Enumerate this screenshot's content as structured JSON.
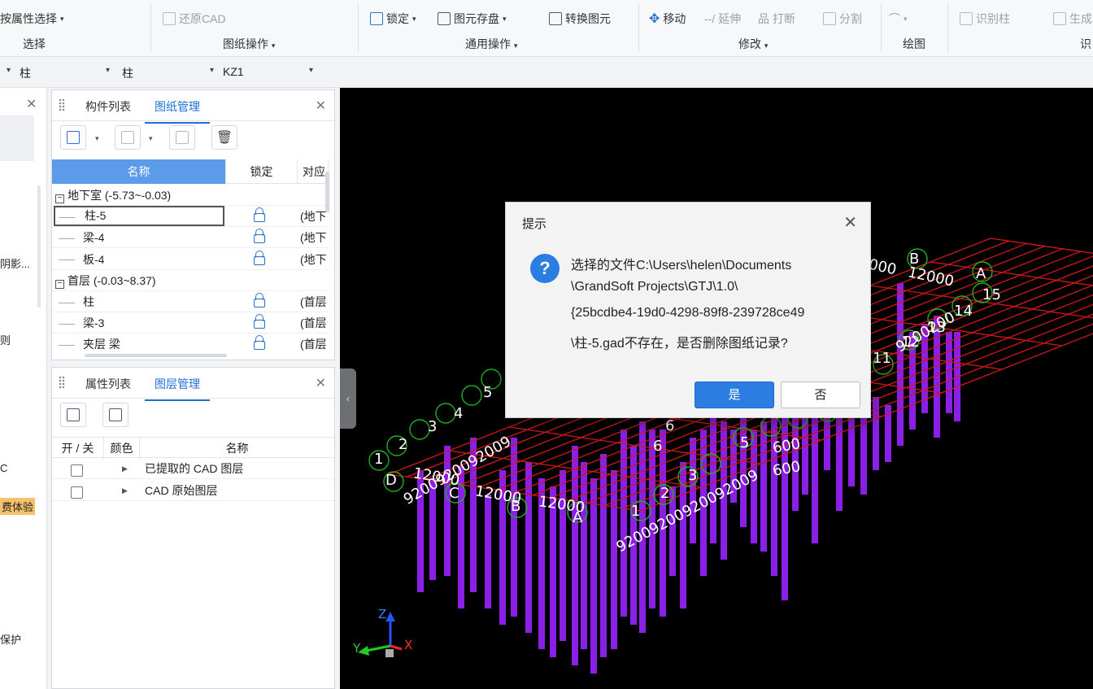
{
  "ribbon": {
    "row1": {
      "prop_select": "按属性选择",
      "restore_cad": "还原CAD",
      "lock": "锁定",
      "save_element": "图元存盘",
      "convert_element": "转换图元",
      "move": "移动",
      "extend": "延伸",
      "break": "打断",
      "split": "分割",
      "identify_column": "识别柱",
      "generate": "生成"
    },
    "groups": {
      "select": "选择",
      "drawing_ops": "图纸操作",
      "common_ops": "通用操作",
      "modify": "修改",
      "draw": "绘图",
      "identify": "识"
    }
  },
  "selector": {
    "floor_partial": "",
    "category": "柱",
    "subcategory": "柱",
    "element": "KZ1"
  },
  "left_strip": {
    "shadow_text": "阴影...",
    "char1": "则",
    "char2": "C",
    "trial_badge": "费体验",
    "protect": "保护"
  },
  "drawing_panel": {
    "tab_components": "构件列表",
    "tab_drawings": "图纸管理",
    "headers": {
      "name": "名称",
      "lock": "锁定",
      "corr": "对应"
    },
    "rows": [
      {
        "type": "group",
        "name": "地下室 (-5.73~-0.03)"
      },
      {
        "type": "item",
        "name": "柱-5",
        "corr": "(地下"
      },
      {
        "type": "item",
        "name": "梁-4",
        "corr": "(地下"
      },
      {
        "type": "item",
        "name": "板-4",
        "corr": "(地下"
      },
      {
        "type": "group",
        "name": "首层 (-0.03~8.37)"
      },
      {
        "type": "item",
        "name": "柱",
        "corr": "(首层"
      },
      {
        "type": "item",
        "name": "梁-3",
        "corr": "(首层"
      },
      {
        "type": "item",
        "name": "夹层 梁",
        "corr": "(首层"
      }
    ]
  },
  "layer_panel": {
    "tab_properties": "属性列表",
    "tab_layers": "图层管理",
    "headers": {
      "toggle": "开 / 关",
      "color": "颜色",
      "name": "名称"
    },
    "rows": [
      {
        "name": "已提取的 CAD 图层"
      },
      {
        "name": "CAD 原始图层"
      }
    ]
  },
  "viewport": {
    "labels": {
      "axis_b_top": "B",
      "axis_a_top": "A",
      "dim_top": "12000",
      "dim_top2": "000",
      "n15": "15",
      "n14": "14",
      "n13": "13",
      "n12": "12",
      "n11": "11",
      "dim_right_chain": "9200200",
      "n1": "1",
      "n2": "2",
      "n3": "3",
      "n4": "4",
      "n5": "5",
      "dim_left_chain": "9200920092009",
      "axis_d": "D",
      "axis_c": "C",
      "axis_b": "B",
      "axis_a": "A",
      "dim_bottom1": "12000",
      "dim_bottom2": "12000",
      "dim_bottom3": "12000",
      "dim_front_chain": "92009200920092009",
      "nf1": "1",
      "nf2": "2",
      "nf3": "3",
      "nf5": "5",
      "n6a": "6",
      "n6b": "6",
      "dim600a": "600",
      "dim600b": "600",
      "axis_x": "X",
      "axis_y": "Y",
      "axis_z": "Z"
    }
  },
  "dialog": {
    "title": "提示",
    "message_lines": [
      "选择的文件C:\\Users\\helen\\Documents",
      "\\GrandSoft Projects\\GTJ\\1.0\\",
      "{25bcdbe4-19d0-4298-89f8-239728ce49",
      "\\柱-5.gad不存在，是否删除图纸记录?"
    ],
    "yes": "是",
    "no": "否"
  },
  "colors": {
    "accent": "#2b7de1",
    "column_purple": "#8a1fe6",
    "grid_red": "#d01818",
    "axis_green": "#1fae1f"
  }
}
